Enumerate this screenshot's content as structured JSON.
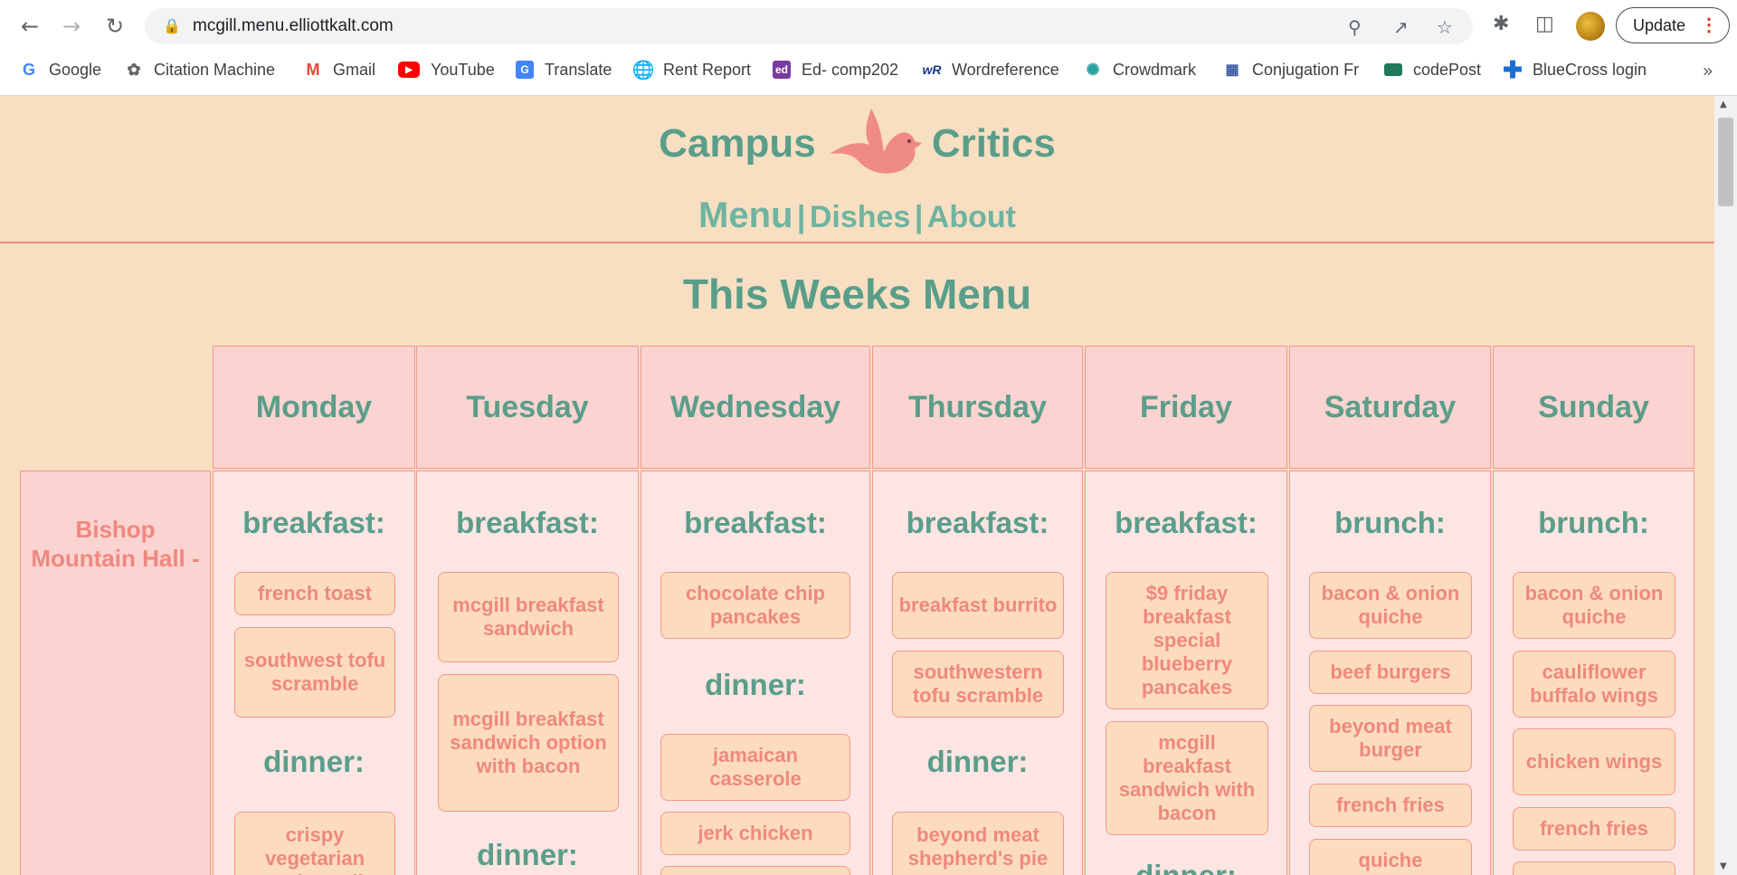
{
  "browser": {
    "url": "mcgill.menu.elliottkalt.com",
    "update_label": "Update",
    "bookmarks": [
      {
        "label": "Google",
        "icon": "google-icon"
      },
      {
        "label": "Citation Machine",
        "icon": "squirrel-icon"
      },
      {
        "label": "Gmail",
        "icon": "gmail-icon"
      },
      {
        "label": "YouTube",
        "icon": "youtube-icon"
      },
      {
        "label": "Translate",
        "icon": "translate-icon"
      },
      {
        "label": "Rent Report",
        "icon": "globe-icon"
      },
      {
        "label": "Ed- comp202",
        "icon": "ed-icon"
      },
      {
        "label": "Wordreference",
        "icon": "wordreference-icon"
      },
      {
        "label": "Crowdmark",
        "icon": "crowdmark-icon"
      },
      {
        "label": "Conjugation Fr",
        "icon": "conjugation-icon"
      },
      {
        "label": "codePost",
        "icon": "codepost-icon"
      },
      {
        "label": "BlueCross login",
        "icon": "bluecross-icon"
      }
    ],
    "more_bookmarks": "»"
  },
  "site": {
    "brand_left": "Campus",
    "brand_right": "Critics",
    "nav": {
      "menu": "Menu",
      "sep1": "|",
      "dishes": "Dishes",
      "sep2": "|",
      "about": "About"
    },
    "heading": "This Weeks Menu",
    "hall": "Bishop Mountain Hall -",
    "days": [
      "Monday",
      "Tuesday",
      "Wednesday",
      "Thursday",
      "Friday",
      "Saturday",
      "Sunday"
    ],
    "columns": [
      {
        "meal1": "breakfast:",
        "dishes1": [
          "french toast",
          "southwest tofu scramble"
        ],
        "meal2": "dinner:",
        "dishes2": [
          "crispy vegetarian spring roll"
        ]
      },
      {
        "meal1": "breakfast:",
        "dishes1": [
          "mcgill breakfast sandwich",
          "mcgill breakfast sandwich option with bacon"
        ],
        "meal2": "dinner:",
        "dishes2": []
      },
      {
        "meal1": "breakfast:",
        "dishes1": [
          "chocolate chip pancakes"
        ],
        "meal2": "dinner:",
        "dishes2": [
          "jamaican casserole",
          "jerk chicken"
        ]
      },
      {
        "meal1": "breakfast:",
        "dishes1": [
          "breakfast burrito",
          "southwestern tofu scramble"
        ],
        "meal2": "dinner:",
        "dishes2": [
          "beyond meat shepherd's pie or sweet"
        ]
      },
      {
        "meal1": "breakfast:",
        "dishes1": [
          "$9 friday breakfast special blueberry pancakes",
          "mcgill breakfast sandwich with bacon"
        ],
        "meal2": "dinner:",
        "dishes2": []
      },
      {
        "meal1": "brunch:",
        "dishes1": [
          "bacon & onion quiche",
          "beef burgers",
          "beyond meat burger",
          "french fries",
          "quiche"
        ]
      },
      {
        "meal1": "brunch:",
        "dishes1": [
          "bacon & onion quiche",
          "cauliflower buffalo wings",
          "chicken wings",
          "french fries"
        ]
      }
    ]
  },
  "colors": {
    "page_bg": "#f8dfc2",
    "teal": "#5a9e8a",
    "coral": "#ef8880",
    "header_cell": "#fbd3d0",
    "dish_bg": "#fcdcbc"
  }
}
